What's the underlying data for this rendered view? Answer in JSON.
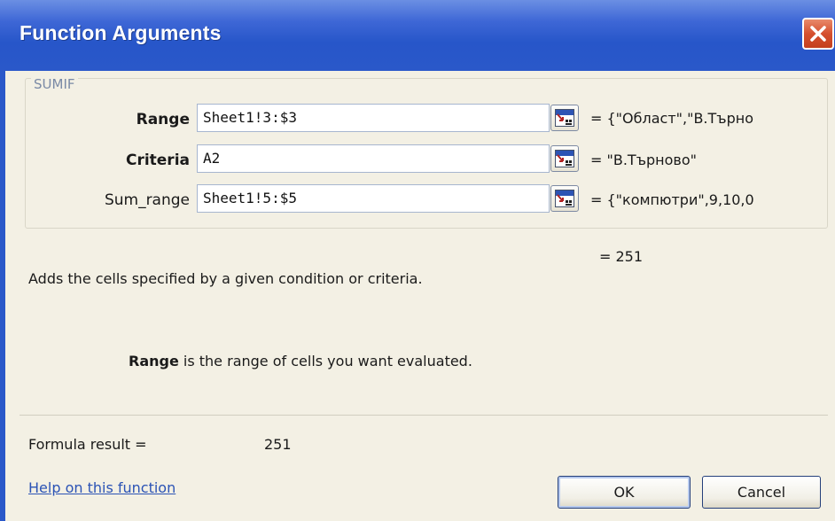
{
  "dialog": {
    "title": "Function Arguments",
    "function_name": "SUMIF"
  },
  "arguments": [
    {
      "label": "Range",
      "bold": true,
      "value": "Sheet1!3:$3",
      "result": "= {\"Област\",\"В.Търно"
    },
    {
      "label": "Criteria",
      "bold": true,
      "value": "A2",
      "result": "= \"В.Търново\""
    },
    {
      "label": "Sum_range",
      "bold": false,
      "value": "Sheet1!5:$5",
      "result": "= {\"компютри\",9,10,0"
    }
  ],
  "result_top": "= 251",
  "description": "Adds the cells specified by a given condition or criteria.",
  "arg_help": {
    "name": "Range",
    "text": " is the range of cells you want evaluated."
  },
  "formula": {
    "label": "Formula result =",
    "value": "251"
  },
  "help_link": "Help on this function",
  "buttons": {
    "ok": "OK",
    "cancel": "Cancel"
  },
  "icons": {
    "close": "close-icon",
    "collapse": "collapse-dialog-icon"
  },
  "colors": {
    "titlebar": "#2a58c9",
    "close": "#d5502f",
    "link": "#2b53b5"
  }
}
